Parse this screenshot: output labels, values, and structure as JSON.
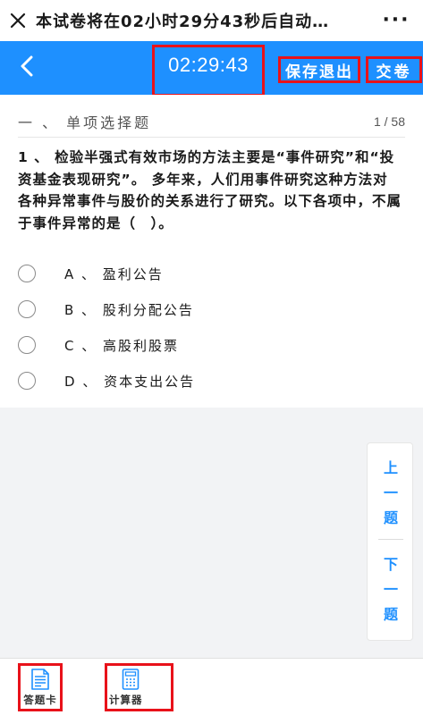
{
  "titlebar": {
    "title": "本试卷将在02小时29分43秒后自动…",
    "more": "···"
  },
  "header": {
    "timer": "02:29:43",
    "save_exit": "保存退出",
    "submit": "交卷",
    "accent_color": "#1e90ff"
  },
  "section": {
    "title": "一 、 单项选择题",
    "progress": "1 / 58"
  },
  "question": {
    "text": "1 、 检验半强式有效市场的方法主要是“事件研究”和“投资基金表现研究”。 多年来，人们用事件研究这种方法对各种异常事件与股价的关系进行了研究。以下各项中，不属于事件异常的是（　）。",
    "options": [
      {
        "label": "A 、 盈利公告"
      },
      {
        "label": "B 、 股利分配公告"
      },
      {
        "label": "C 、 高股利股票"
      },
      {
        "label": "D 、 资本支出公告"
      }
    ]
  },
  "nav": {
    "prev": [
      "上",
      "一",
      "题"
    ],
    "next": [
      "下",
      "一",
      "题"
    ]
  },
  "footer": {
    "answer_card": "答题卡",
    "calculator": "计算器"
  },
  "icons": {
    "close": "close-icon",
    "back": "chevron-left-icon",
    "answer_card": "answer-sheet-icon",
    "calculator": "calculator-icon"
  }
}
